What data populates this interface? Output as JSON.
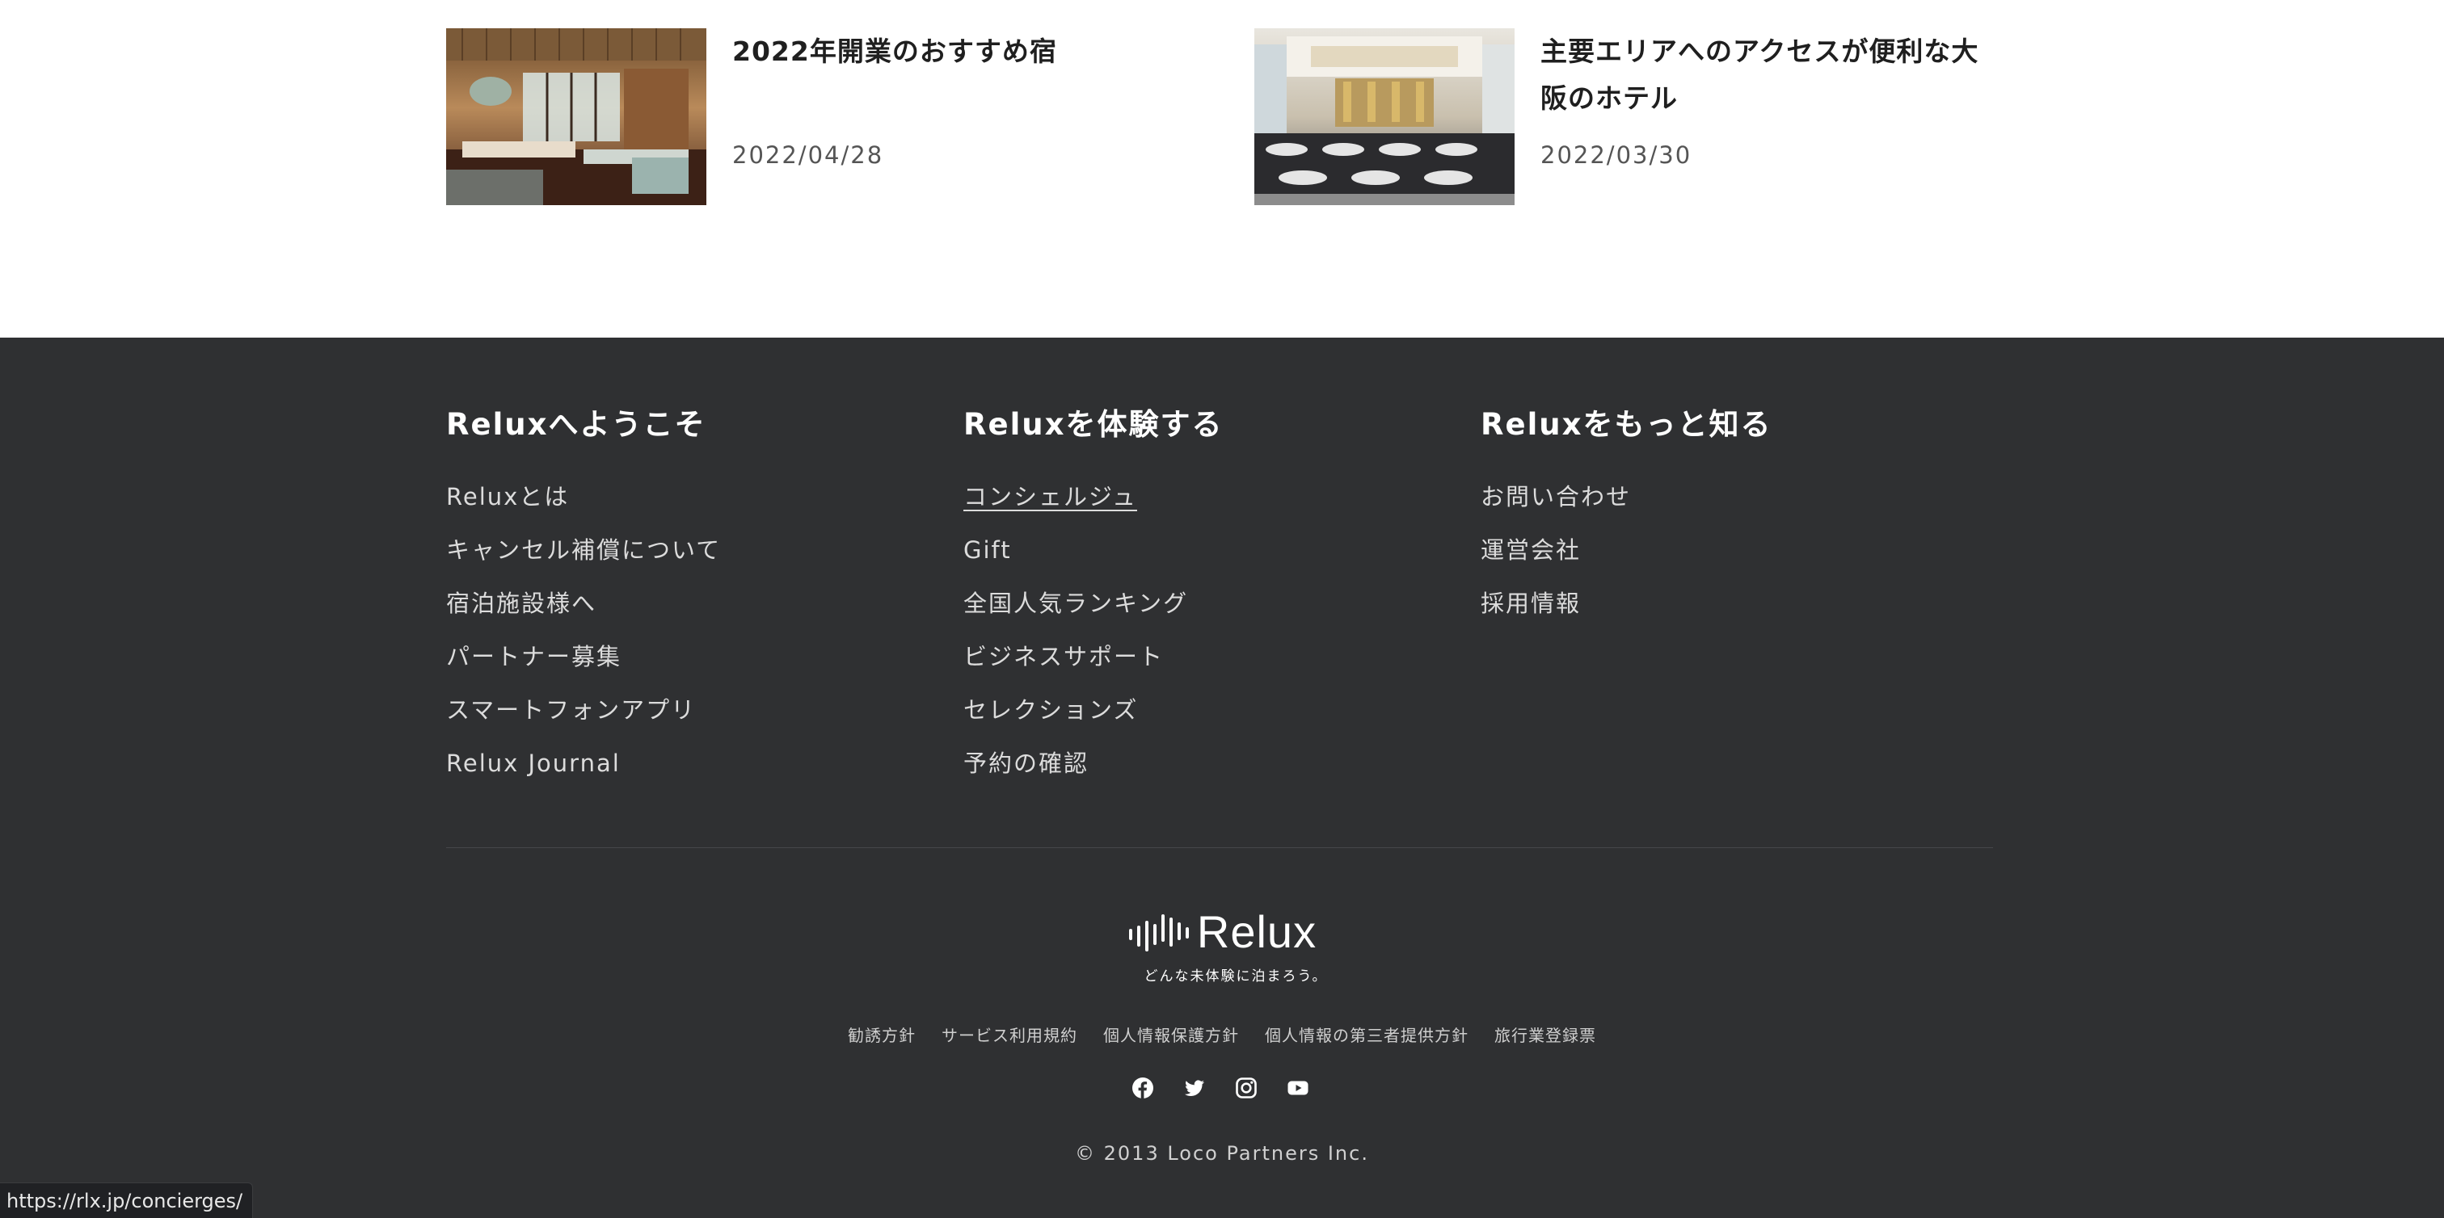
{
  "articles": [
    {
      "title": "2022年開業のおすすめ宿",
      "date": "2022/04/28"
    },
    {
      "title_line1": "主要エリアへのアクセスが便利な大",
      "title_line2": "阪のホテル",
      "date": "2022/03/30"
    }
  ],
  "footer": {
    "columns": [
      {
        "heading": "Reluxへようこそ",
        "links": [
          "Reluxとは",
          "キャンセル補償について",
          "宿泊施設様へ",
          "パートナー募集",
          "スマートフォンアプリ",
          "Relux Journal"
        ]
      },
      {
        "heading": "Reluxを体験する",
        "links": [
          "コンシェルジュ",
          "Gift",
          "全国人気ランキング",
          "ビジネスサポート",
          "セレクションズ",
          "予約の確認"
        ]
      },
      {
        "heading": "Reluxをもっと知る",
        "links": [
          "お問い合わせ",
          "運営会社",
          "採用情報"
        ]
      }
    ],
    "brand": {
      "logo_text": "Relux",
      "tagline": "どんな未体験に泊まろう。"
    },
    "legal_links": [
      "勧誘方針",
      "サービス利用規約",
      "個人情報保護方針",
      "個人情報の第三者提供方針",
      "旅行業登録票"
    ],
    "social_icons": [
      "facebook-icon",
      "twitter-icon",
      "instagram-icon",
      "youtube-icon"
    ],
    "copyright": "© 2013 Loco Partners Inc."
  },
  "status_bar": {
    "url": "https://rlx.jp/concierges/"
  },
  "colors": {
    "footer_bg": "#2f3032",
    "page_bg": "#ffffff",
    "heading_text": "#ffffff",
    "link_text": "#dcdcdc"
  }
}
